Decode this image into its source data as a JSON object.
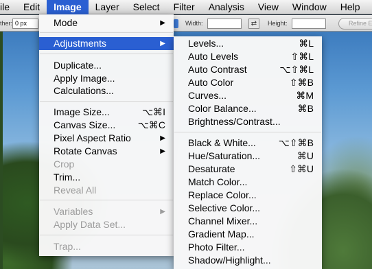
{
  "menubar": {
    "items": [
      "ile",
      "Edit",
      "Image",
      "Layer",
      "Select",
      "Filter",
      "Analysis",
      "View",
      "Window",
      "Help"
    ],
    "active_index": 2
  },
  "options_bar": {
    "feather_label": "ther:",
    "feather_value": "0 px",
    "width_label": "Width:",
    "height_label": "Height:",
    "refine_button": "Refine E",
    "swap_icon": "swap-arrows-icon"
  },
  "image_menu": {
    "mode": "Mode",
    "adjustments": "Adjustments",
    "duplicate": "Duplicate...",
    "apply_image": "Apply Image...",
    "calculations": "Calculations...",
    "image_size": "Image Size...",
    "image_size_sc": "⌥⌘I",
    "canvas_size": "Canvas Size...",
    "canvas_size_sc": "⌥⌘C",
    "pixel_aspect_ratio": "Pixel Aspect Ratio",
    "rotate_canvas": "Rotate Canvas",
    "crop": "Crop",
    "trim": "Trim...",
    "reveal_all": "Reveal All",
    "variables": "Variables",
    "apply_data_set": "Apply Data Set...",
    "trap": "Trap..."
  },
  "adjustments_menu": {
    "levels": "Levels...",
    "levels_sc": "⌘L",
    "auto_levels": "Auto Levels",
    "auto_levels_sc": "⇧⌘L",
    "auto_contrast": "Auto Contrast",
    "auto_contrast_sc": "⌥⇧⌘L",
    "auto_color": "Auto Color",
    "auto_color_sc": "⇧⌘B",
    "curves": "Curves...",
    "curves_sc": "⌘M",
    "color_balance": "Color Balance...",
    "color_balance_sc": "⌘B",
    "brightness_contrast": "Brightness/Contrast...",
    "black_white": "Black & White...",
    "black_white_sc": "⌥⇧⌘B",
    "hue_saturation": "Hue/Saturation...",
    "hue_saturation_sc": "⌘U",
    "desaturate": "Desaturate",
    "desaturate_sc": "⇧⌘U",
    "match_color": "Match Color...",
    "replace_color": "Replace Color...",
    "selective_color": "Selective Color...",
    "channel_mixer": "Channel Mixer...",
    "gradient_map": "Gradient Map...",
    "photo_filter": "Photo Filter...",
    "shadow_highlight": "Shadow/Highlight..."
  },
  "colors": {
    "highlight": "#2a5fd2",
    "disabled_text": "#9c9c9c"
  }
}
